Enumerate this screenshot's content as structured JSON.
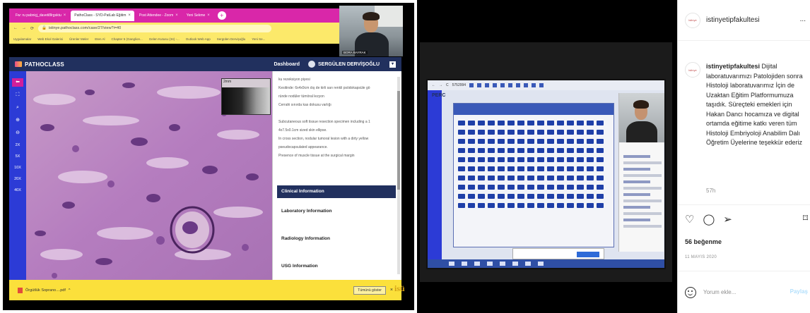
{
  "left": {
    "browser": {
      "tabs": [
        {
          "label": "Fw: ru pabniçj_daveti8lrgsktu",
          "active": false
        },
        {
          "label": "PathoClass - SYD-PatLab Eğitim",
          "active": true
        },
        {
          "label": "Post Attendee - Zoom",
          "active": false
        },
        {
          "label": "Yeni Sekme",
          "active": false
        }
      ],
      "url": "istinye.pathoclass.com/case/27/view?i=40",
      "bookmarks": [
        "Uygulamalar",
        "Web Ekol Galerisi",
        "Ürenler Meler",
        "Eten Al",
        "Chapter 5 (Ganglion...",
        "Gelen Kutusu (34) -...",
        "Outlook Web App",
        "Sergülen Dervişoğlu",
        "Yeni Se..."
      ]
    },
    "webcam_name": "BORA BAYRAK",
    "app": {
      "brand": "PATHOCLASS",
      "dashboard": "Dashboard",
      "user": "SERGÜLEN DERVİŞOĞLU"
    },
    "zoom_levels": [
      "2X",
      "5X",
      "10X",
      "20X",
      "40X"
    ],
    "thumbnail_label": "2mm",
    "case_text": [
      "ku rezeksiyon piyesi",
      "Kesitinde: 6x4x9cm dış de kirli sarı renkli psödokapsüle gö",
      "ründe nodüler tümöral lezyon",
      "Cerrahi sınırda kas dokusu varlığı",
      "Subcutaneous soft tissue resection specimen including a 1",
      "4x7.5x0.1cm sized skin ellipse.",
      "In cross section, nodular tumoral lesion with a dirty yellow",
      "pseudocapsulated appearance.",
      "Presence of muscle tissue at the surgical margin"
    ],
    "sections": {
      "clinical": "Clinical Information",
      "laboratory": "Laboratory Information",
      "radiology": "Radiology Information",
      "usg": "USG Information"
    },
    "download": {
      "file": "Örgütlük Soprano....pdf",
      "show_all": "Tümünü göster"
    },
    "watermark": "isü"
  },
  "right": {
    "monitor": {
      "app_label": "PERC",
      "top_text": "5752994"
    },
    "instagram": {
      "handle": "istinyetipfakultesi",
      "more": "...",
      "caption_handle": "istinyetipfakultesi",
      "caption": "Dijital laboratuvarımızı Patolojiden sonra Histoloji laboratuvarımız İçin de Uzaktan Eğitim Platformumuza taşıdık. Süreçteki emekleri için Hakan Dancı hocamıza ve digital ortamda eğitime katkı veren tüm Histoloji Embriyoloji Anabilim Dalı Öğretim Üyelerine teşekkür ederiz",
      "time": "57h",
      "likes": "56 beğenme",
      "date": "11 MAYIS 2020",
      "comment_placeholder": "Yorum ekle...",
      "post_button": "Paylaş"
    }
  }
}
